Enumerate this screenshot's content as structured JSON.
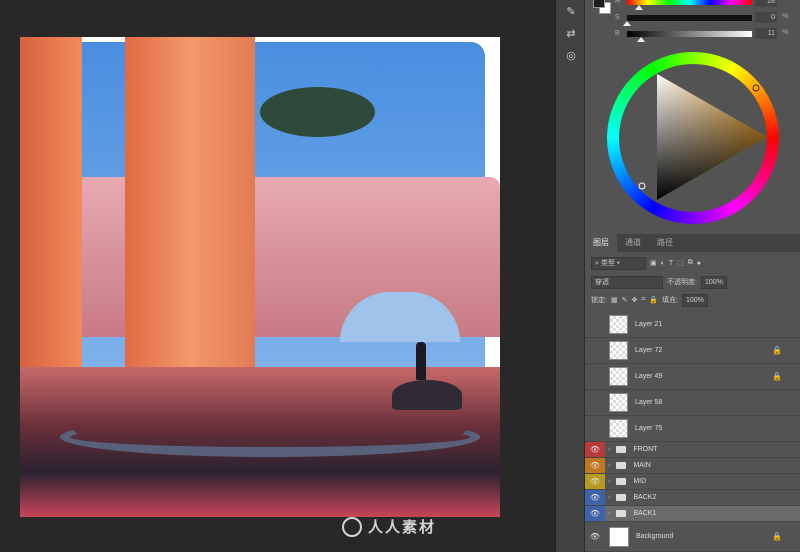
{
  "color_panel": {
    "sliders": [
      {
        "label": "H",
        "value": "28",
        "unit": "°",
        "position": 0.08
      },
      {
        "label": "S",
        "value": "0",
        "unit": "%",
        "position": 0.0
      },
      {
        "label": "B",
        "value": "11",
        "unit": "%",
        "position": 0.11
      }
    ]
  },
  "layers_panel": {
    "tabs": [
      "图层",
      "通道",
      "路径"
    ],
    "filter_kind": "类型",
    "blend_mode": "穿透",
    "opacity_label": "不透明度:",
    "opacity_value": "100%",
    "lock_label": "锁定:",
    "fill_label": "填充:",
    "fill_value": "100%",
    "layers": [
      {
        "name": "Layer 21",
        "locked": false
      },
      {
        "name": "Layer 72",
        "locked": true
      },
      {
        "name": "Layer 49",
        "locked": true
      },
      {
        "name": "Layer 58",
        "locked": false
      },
      {
        "name": "Layer 75",
        "locked": false
      }
    ],
    "groups": [
      {
        "name": "FRONT",
        "color": "#b83a3a"
      },
      {
        "name": "MAIN",
        "color": "#c0771e"
      },
      {
        "name": "MID",
        "color": "#b89a1e"
      },
      {
        "name": "BACK2",
        "color": "#3f63a8"
      },
      {
        "name": "BACK1",
        "color": "#3f63a8"
      }
    ],
    "background": {
      "name": "Background"
    }
  },
  "watermark": "人人素材"
}
